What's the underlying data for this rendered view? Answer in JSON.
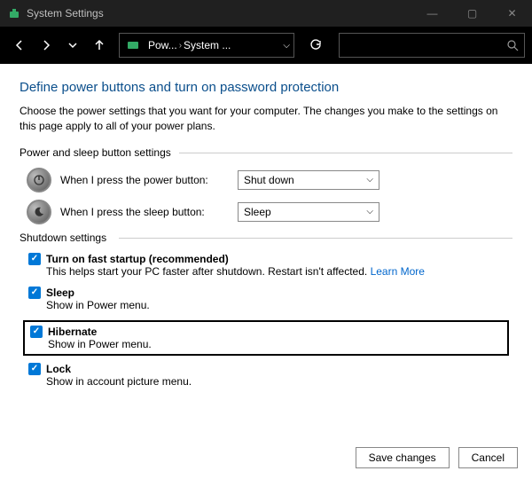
{
  "window": {
    "title": "System Settings",
    "controls": {
      "min": "—",
      "max": "▢",
      "close": "✕"
    }
  },
  "nav": {
    "crumb1": "Pow...",
    "crumb2": "System ...",
    "search_placeholder": ""
  },
  "page": {
    "heading": "Define power buttons and turn on password protection",
    "desc": "Choose the power settings that you want for your computer. The changes you make to the settings on this page apply to all of your power plans.",
    "section1_label": "Power and sleep button settings",
    "row1_label": "When I press the power button:",
    "row1_value": "Shut down",
    "row2_label": "When I press the sleep button:",
    "row2_value": "Sleep",
    "section2_label": "Shutdown settings",
    "cb1_title": "Turn on fast startup (recommended)",
    "cb1_desc": "This helps start your PC faster after shutdown. Restart isn't affected. ",
    "cb1_link": "Learn More",
    "cb2_title": "Sleep",
    "cb2_desc": "Show in Power menu.",
    "cb3_title": "Hibernate",
    "cb3_desc": "Show in Power menu.",
    "cb4_title": "Lock",
    "cb4_desc": "Show in account picture menu."
  },
  "footer": {
    "save": "Save changes",
    "cancel": "Cancel"
  }
}
